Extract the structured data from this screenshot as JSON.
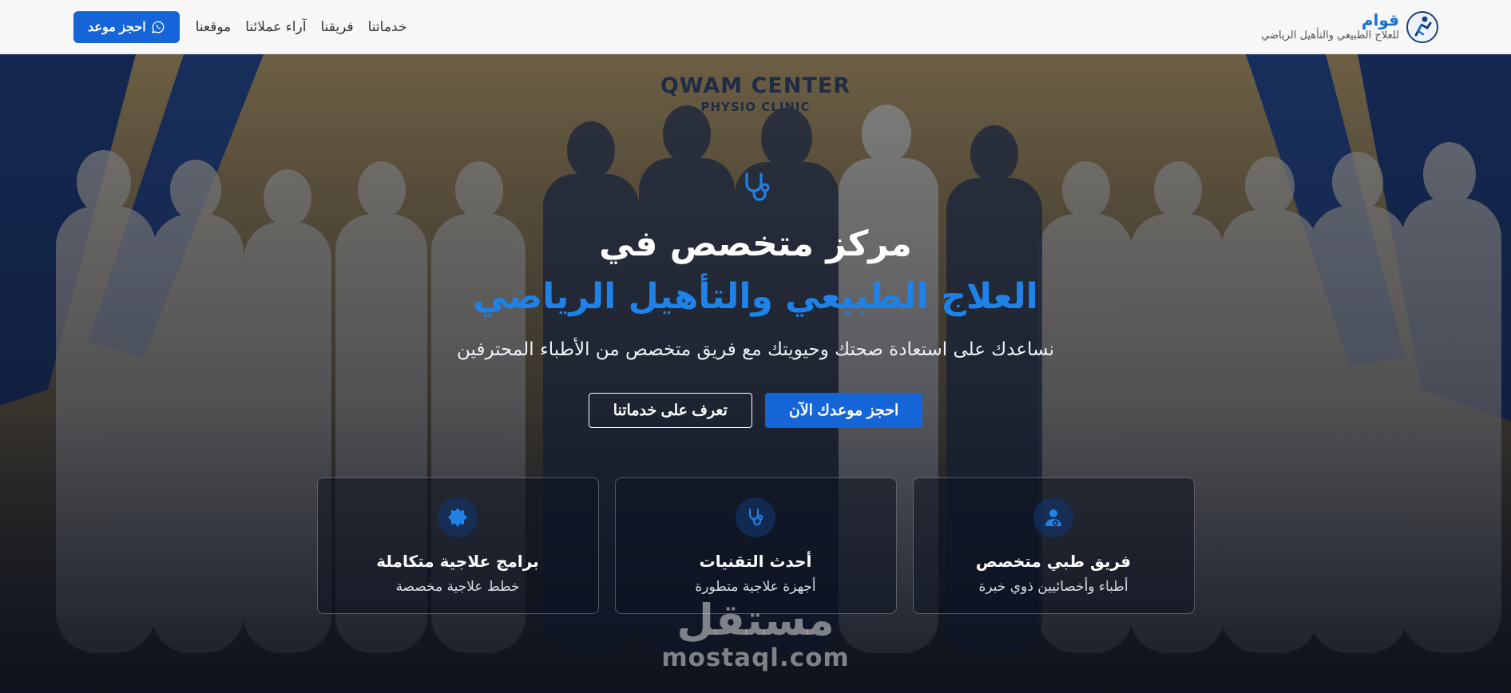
{
  "header": {
    "brand_name": "قوام",
    "brand_tagline": "للعلاج الطبيعي والتأهيل الرياضي",
    "nav": [
      {
        "label": "خدماتنا"
      },
      {
        "label": "فريقنا"
      },
      {
        "label": "آراء عملائنا"
      },
      {
        "label": "موقعنا"
      }
    ],
    "book_button": "احجز موعد",
    "book_icon": "whatsapp-icon"
  },
  "hero": {
    "backdrop_line1": "QWAM CENTER",
    "backdrop_line2": "PHYSIO CLINIC",
    "icon": "stethoscope-icon",
    "title_line1": "مركز متخصص في",
    "title_line2": "العلاج الطبيعي والتأهيل الرياضي",
    "subtitle": "نساعدك على استعادة صحتك وحيويتك مع فريق متخصص من الأطباء المحترفين",
    "primary_cta": "احجز موعدك الآن",
    "secondary_cta": "تعرف على خدماتنا",
    "features": [
      {
        "icon": "doctor-icon",
        "title": "فريق طبي متخصص",
        "desc": "أطباء وأخصائيين ذوي خبرة"
      },
      {
        "icon": "stethoscope-icon",
        "title": "أحدث التقنيات",
        "desc": "أجهزة علاجية متطورة"
      },
      {
        "icon": "badge-icon",
        "title": "برامج علاجية متكاملة",
        "desc": "خطط علاجية مخصصة"
      }
    ]
  },
  "watermark": {
    "arabic": "مستقل",
    "latin": "mostaql.com"
  },
  "colors": {
    "accent": "#1565d8",
    "title_blue": "#1e82e8",
    "header_bg": "#f7f7f7"
  }
}
